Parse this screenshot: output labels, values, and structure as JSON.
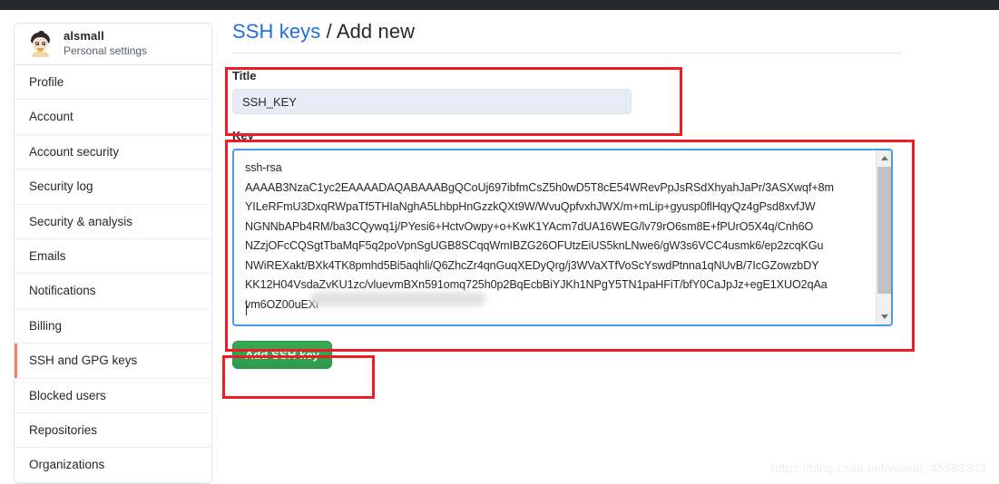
{
  "window": {
    "topbar_color": "#24292e",
    "background": "#ffffff"
  },
  "sidebar": {
    "user": {
      "name": "alsmall",
      "subtitle": "Personal settings",
      "avatar_icon": "user-avatar-cartoon"
    },
    "items": [
      {
        "label": "Profile",
        "selected": false
      },
      {
        "label": "Account",
        "selected": false
      },
      {
        "label": "Account security",
        "selected": false
      },
      {
        "label": "Security log",
        "selected": false
      },
      {
        "label": "Security & analysis",
        "selected": false
      },
      {
        "label": "Emails",
        "selected": false
      },
      {
        "label": "Notifications",
        "selected": false
      },
      {
        "label": "Billing",
        "selected": false
      },
      {
        "label": "SSH and GPG keys",
        "selected": true
      },
      {
        "label": "Blocked users",
        "selected": false
      },
      {
        "label": "Repositories",
        "selected": false
      },
      {
        "label": "Organizations",
        "selected": false
      }
    ],
    "selected_marker_color": "#f9826c"
  },
  "main": {
    "title": {
      "link_text": "SSH keys",
      "separator": " / ",
      "current": "Add new",
      "link_color": "#1f6fdd"
    },
    "title_field": {
      "label": "Title",
      "value": "SSH_KEY",
      "placeholder": "",
      "background": "#e7ecf7"
    },
    "key_field": {
      "label": "Key",
      "placeholder": "",
      "focus_border_color": "#4a9ae8",
      "value": "ssh-rsa\nAAAAB3NzaC1yc2EAAAADAQABAAABgQCoUj697ibfmCsZ5h0wD5T8cE54WRevPpJsRSdXhyahJaPr/3ASXwqf+8m\nYILeRFmU3DxqRWpaTf5THIaNghA5LhbpHnGzzkQXt9W/WvuQpfvxhJWX/m+mLip+gyusp0flHqyQz4gPsd8xvfJW\nNGNNbAPb4RM/ba3CQywq1j/PYesi6+HctvOwpy+o+KwK1YAcm7dUA16WEG/lv79rO6sm8E+fPUrO5X4q/Cnh6O\nNZzjOFcCQSgtTbaMqF5q2poVpnSgUGB8SCqqWmIBZG26OFUtzEiUS5knLNwe6/gW3s6VCC4usmk6/ep2zcqKGu\nNWiREXakt/BXk4TK8pmhd5Bi5aqhli/Q6ZhcZr4qnGuqXEDyQrg/j3WVaXTfVoScYswdPtnna1qNUvB/7IcGZowzbDY\nKK12H04VsdaZvKU1zc/vluevmBXn591omq725h0p2BqEcbBiYJKh1NPgY5TN1paHFiT/bfY0CaJpJz+egE1XUO2qAa\nvm6OZ00uEXi",
      "redacted": true,
      "scrollbar": {
        "up_arrow_icon": "triangle-up-icon",
        "down_arrow_icon": "triangle-down-icon"
      }
    },
    "submit_button": {
      "label": "Add SSH key",
      "color": "#2ea44f"
    }
  },
  "annotations": {
    "box_color": "#ee1c25",
    "boxes": [
      "title-field",
      "key-field",
      "submit-button"
    ]
  },
  "watermark": {
    "text": "https://blog.csdn.net/weixin_45583303"
  }
}
